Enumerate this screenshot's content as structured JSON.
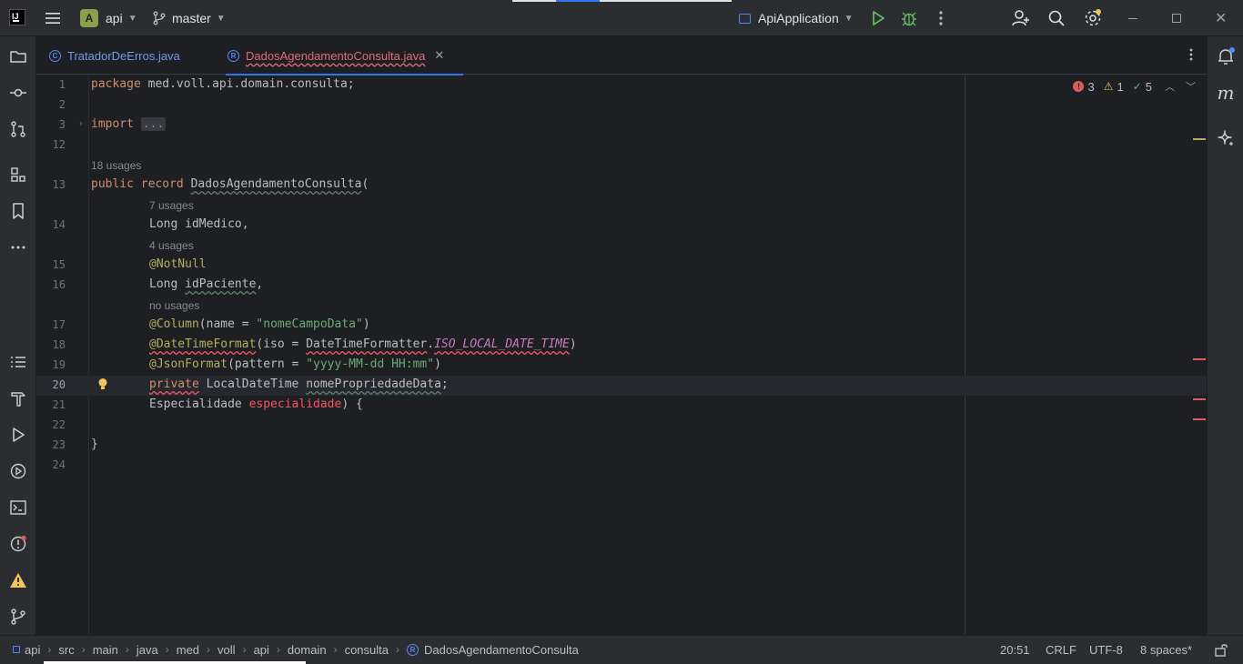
{
  "titlebar": {
    "project_letter": "A",
    "project_name": "api",
    "branch": "master",
    "run_config": "ApiApplication"
  },
  "tabs": [
    {
      "icon_letter": "C",
      "label": "TratadorDeErros.java",
      "active": false
    },
    {
      "icon_letter": "R",
      "label": "DadosAgendamentoConsulta.java",
      "active": true
    }
  ],
  "inspections": {
    "errors": "3",
    "warnings": "1",
    "ok": "5"
  },
  "editor": {
    "hints": {
      "record_usages": "18 usages",
      "idMedico_usages": "7 usages",
      "idPaciente_usages": "4 usages",
      "data_usages": "no usages"
    },
    "lines": {
      "l1": "1",
      "l2": "2",
      "l3": "3",
      "l12": "12",
      "l13": "13",
      "l14": "14",
      "l15": "15",
      "l16": "16",
      "l17": "17",
      "l18": "18",
      "l19": "19",
      "l20": "20",
      "l21": "21",
      "l22": "22",
      "l23": "23",
      "l24": "24"
    },
    "code": {
      "package_kw": "package",
      "package_name": " med.voll.api.domain.consulta;",
      "import_kw": "import",
      "import_fold": "...",
      "public_kw": "public",
      "record_kw": "record",
      "record_name": "DadosAgendamentoConsulta",
      "record_open": "(",
      "l14_text": "Long idMedico,",
      "l15_ann": "@NotNull",
      "l16_type": "Long ",
      "l16_name": "idPaciente",
      "l16_end": ",",
      "l17_ann": "@Column",
      "l17_mid": "(name = ",
      "l17_str": "\"nomeCampoData\"",
      "l17_end": ")",
      "l18_ann": "@DateTimeFormat",
      "l18_mid": "(iso = ",
      "l18_cls": "DateTimeFormatter",
      "l18_dot": ".",
      "l18_fld": "ISO_LOCAL_DATE_TIME",
      "l18_end": ")",
      "l19_ann": "@JsonFormat",
      "l19_mid": "(pattern = ",
      "l19_str": "\"yyyy-MM-dd HH:mm\"",
      "l19_end": ")",
      "l20_kw": "private",
      "l20_type": " LocalDateTime ",
      "l20_name": "nomePropriedadeData",
      "l20_end": ";",
      "l21_type": "Especialidade ",
      "l21_name": "especialidade",
      "l21_end": ") {",
      "l23_text": "}"
    }
  },
  "breadcrumbs": [
    "api",
    "src",
    "main",
    "java",
    "med",
    "voll",
    "api",
    "domain",
    "consulta",
    "DadosAgendamentoConsulta"
  ],
  "status": {
    "position": "20:51",
    "line_sep": "CRLF",
    "encoding": "UTF-8",
    "indent": "8 spaces*"
  },
  "colors": {
    "background": "#1e1f22",
    "panel": "#2b2d30",
    "accent": "#3574f0",
    "keyword": "#cf8e6d",
    "annotation": "#b3ae60",
    "string": "#6aab73",
    "error": "#f75464"
  }
}
